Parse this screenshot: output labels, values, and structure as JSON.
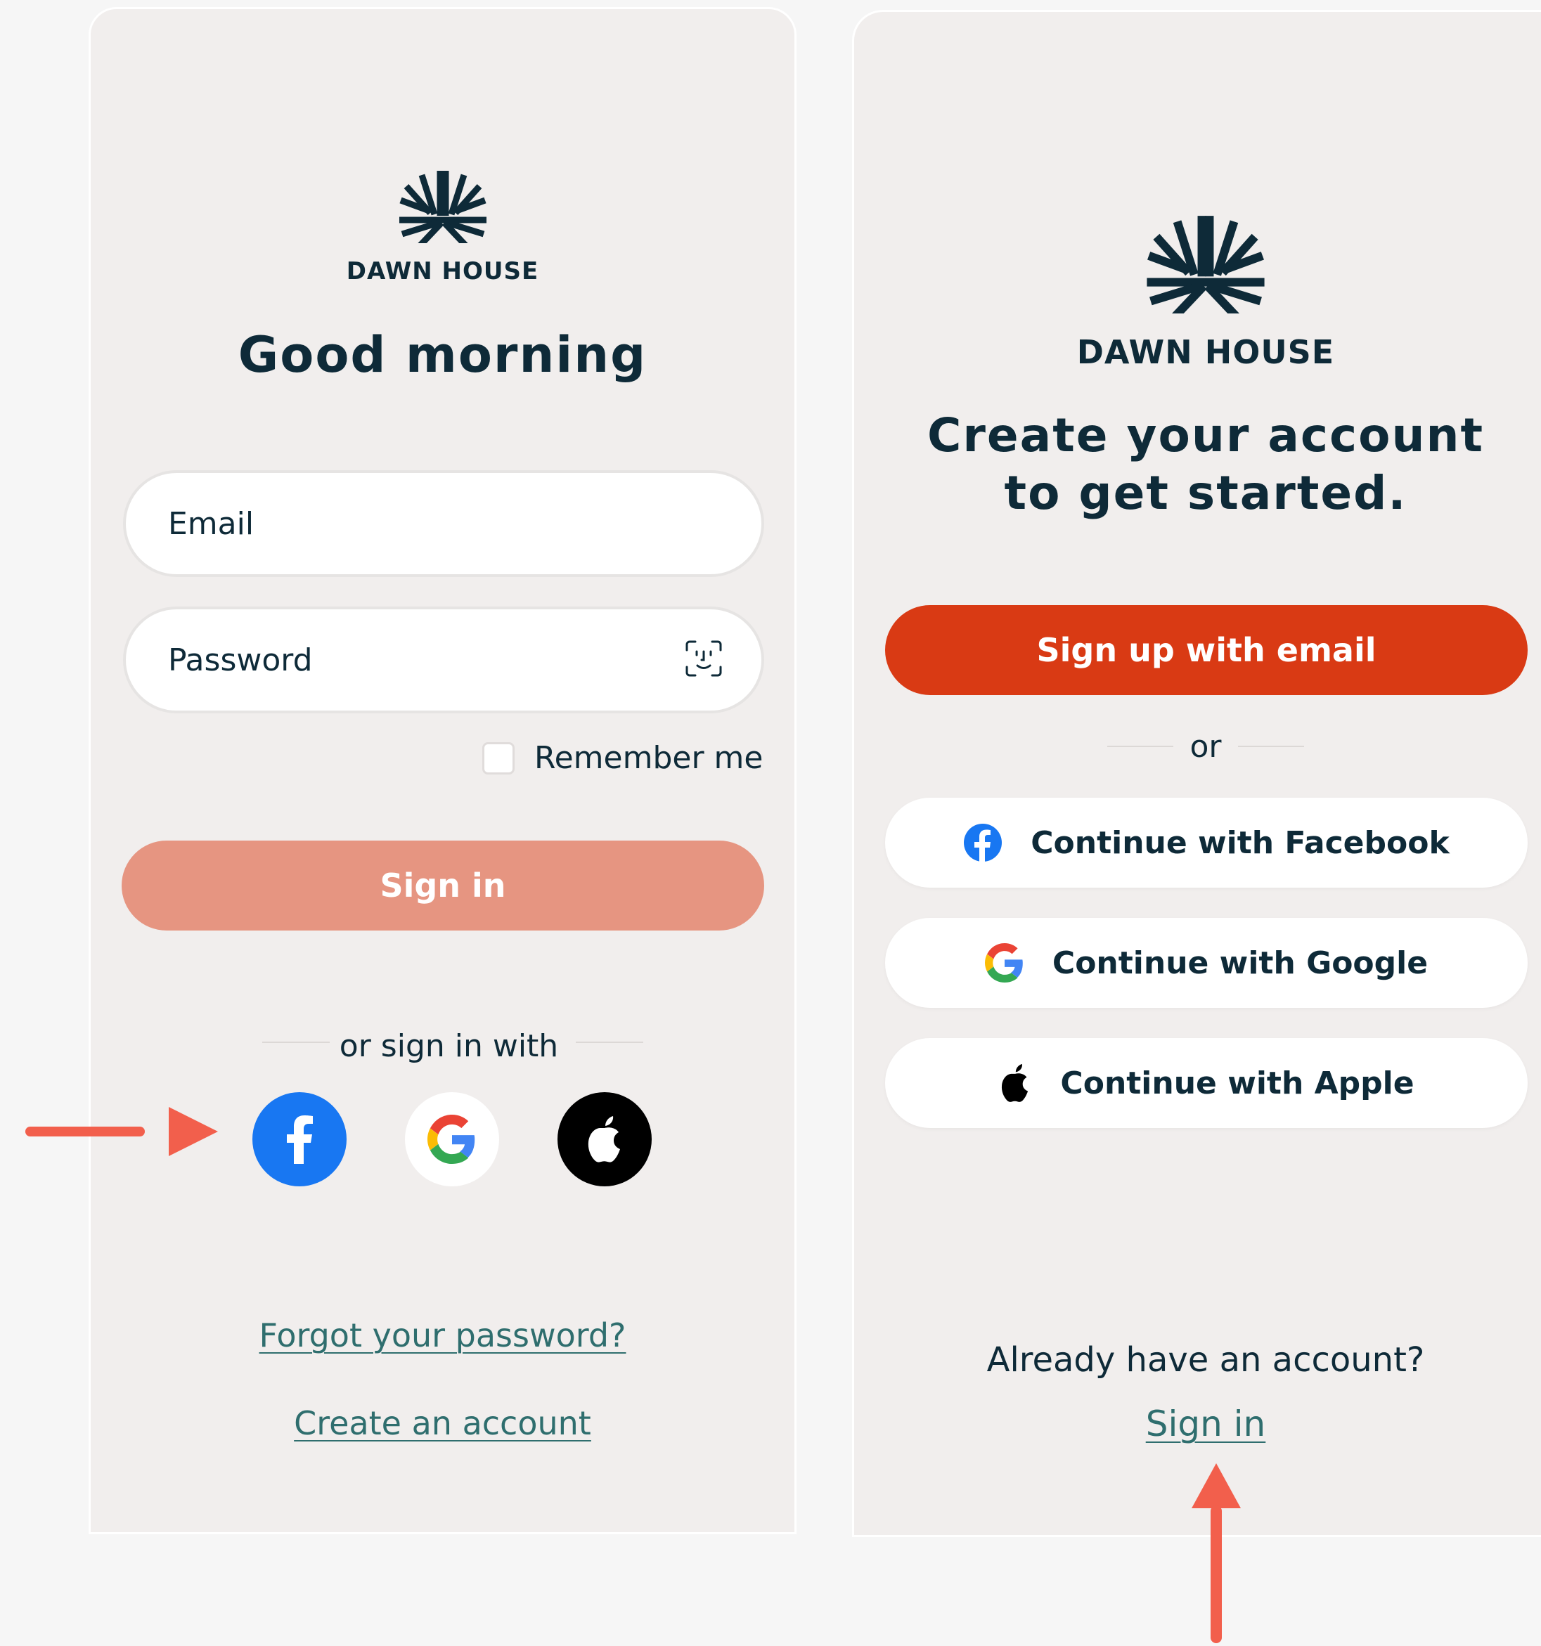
{
  "brand": {
    "name": "DAWN HOUSE"
  },
  "login": {
    "greeting": "Good morning",
    "email_placeholder": "Email",
    "password_placeholder": "Password",
    "remember_label": "Remember me",
    "signin_label": "Sign in",
    "divider_label": "or sign in with",
    "forgot_link": "Forgot your password?",
    "create_link": "Create an account"
  },
  "signup": {
    "heading_line1": "Create your account",
    "heading_line2": "to get started.",
    "email_button": "Sign up with email",
    "divider_label": "or",
    "facebook_button": "Continue with Facebook",
    "google_button": "Continue with Google",
    "apple_button": "Continue with Apple",
    "already_label": "Already have an account?",
    "signin_link": "Sign in"
  },
  "icons": {
    "logo": "sunrise-logo-icon",
    "face_id": "face-id-icon",
    "facebook": "facebook-icon",
    "google": "google-icon",
    "apple": "apple-icon",
    "annotation_arrow": "arrow-icon"
  },
  "colors": {
    "navy": "#0e2a38",
    "signin_disabled": "#e69581",
    "signup_primary": "#d93a14",
    "link_teal": "#2f6e6e",
    "facebook_blue": "#1877f2",
    "annotation_red": "#f25f4c",
    "panel_bg": "#f1eeed"
  }
}
